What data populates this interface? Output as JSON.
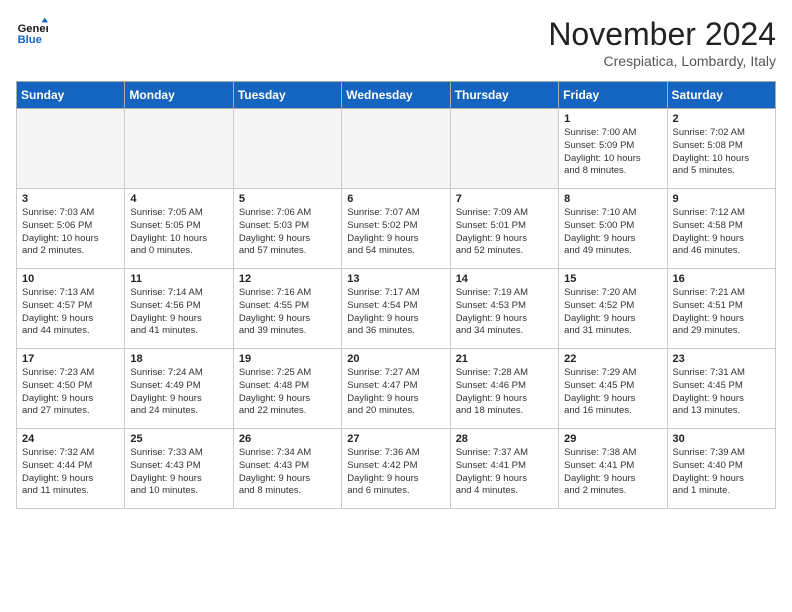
{
  "header": {
    "logo_line1": "General",
    "logo_line2": "Blue",
    "month": "November 2024",
    "location": "Crespiatica, Lombardy, Italy"
  },
  "weekdays": [
    "Sunday",
    "Monday",
    "Tuesday",
    "Wednesday",
    "Thursday",
    "Friday",
    "Saturday"
  ],
  "weeks": [
    [
      {
        "day": "",
        "info": ""
      },
      {
        "day": "",
        "info": ""
      },
      {
        "day": "",
        "info": ""
      },
      {
        "day": "",
        "info": ""
      },
      {
        "day": "",
        "info": ""
      },
      {
        "day": "1",
        "info": "Sunrise: 7:00 AM\nSunset: 5:09 PM\nDaylight: 10 hours\nand 8 minutes."
      },
      {
        "day": "2",
        "info": "Sunrise: 7:02 AM\nSunset: 5:08 PM\nDaylight: 10 hours\nand 5 minutes."
      }
    ],
    [
      {
        "day": "3",
        "info": "Sunrise: 7:03 AM\nSunset: 5:06 PM\nDaylight: 10 hours\nand 2 minutes."
      },
      {
        "day": "4",
        "info": "Sunrise: 7:05 AM\nSunset: 5:05 PM\nDaylight: 10 hours\nand 0 minutes."
      },
      {
        "day": "5",
        "info": "Sunrise: 7:06 AM\nSunset: 5:03 PM\nDaylight: 9 hours\nand 57 minutes."
      },
      {
        "day": "6",
        "info": "Sunrise: 7:07 AM\nSunset: 5:02 PM\nDaylight: 9 hours\nand 54 minutes."
      },
      {
        "day": "7",
        "info": "Sunrise: 7:09 AM\nSunset: 5:01 PM\nDaylight: 9 hours\nand 52 minutes."
      },
      {
        "day": "8",
        "info": "Sunrise: 7:10 AM\nSunset: 5:00 PM\nDaylight: 9 hours\nand 49 minutes."
      },
      {
        "day": "9",
        "info": "Sunrise: 7:12 AM\nSunset: 4:58 PM\nDaylight: 9 hours\nand 46 minutes."
      }
    ],
    [
      {
        "day": "10",
        "info": "Sunrise: 7:13 AM\nSunset: 4:57 PM\nDaylight: 9 hours\nand 44 minutes."
      },
      {
        "day": "11",
        "info": "Sunrise: 7:14 AM\nSunset: 4:56 PM\nDaylight: 9 hours\nand 41 minutes."
      },
      {
        "day": "12",
        "info": "Sunrise: 7:16 AM\nSunset: 4:55 PM\nDaylight: 9 hours\nand 39 minutes."
      },
      {
        "day": "13",
        "info": "Sunrise: 7:17 AM\nSunset: 4:54 PM\nDaylight: 9 hours\nand 36 minutes."
      },
      {
        "day": "14",
        "info": "Sunrise: 7:19 AM\nSunset: 4:53 PM\nDaylight: 9 hours\nand 34 minutes."
      },
      {
        "day": "15",
        "info": "Sunrise: 7:20 AM\nSunset: 4:52 PM\nDaylight: 9 hours\nand 31 minutes."
      },
      {
        "day": "16",
        "info": "Sunrise: 7:21 AM\nSunset: 4:51 PM\nDaylight: 9 hours\nand 29 minutes."
      }
    ],
    [
      {
        "day": "17",
        "info": "Sunrise: 7:23 AM\nSunset: 4:50 PM\nDaylight: 9 hours\nand 27 minutes."
      },
      {
        "day": "18",
        "info": "Sunrise: 7:24 AM\nSunset: 4:49 PM\nDaylight: 9 hours\nand 24 minutes."
      },
      {
        "day": "19",
        "info": "Sunrise: 7:25 AM\nSunset: 4:48 PM\nDaylight: 9 hours\nand 22 minutes."
      },
      {
        "day": "20",
        "info": "Sunrise: 7:27 AM\nSunset: 4:47 PM\nDaylight: 9 hours\nand 20 minutes."
      },
      {
        "day": "21",
        "info": "Sunrise: 7:28 AM\nSunset: 4:46 PM\nDaylight: 9 hours\nand 18 minutes."
      },
      {
        "day": "22",
        "info": "Sunrise: 7:29 AM\nSunset: 4:45 PM\nDaylight: 9 hours\nand 16 minutes."
      },
      {
        "day": "23",
        "info": "Sunrise: 7:31 AM\nSunset: 4:45 PM\nDaylight: 9 hours\nand 13 minutes."
      }
    ],
    [
      {
        "day": "24",
        "info": "Sunrise: 7:32 AM\nSunset: 4:44 PM\nDaylight: 9 hours\nand 11 minutes."
      },
      {
        "day": "25",
        "info": "Sunrise: 7:33 AM\nSunset: 4:43 PM\nDaylight: 9 hours\nand 10 minutes."
      },
      {
        "day": "26",
        "info": "Sunrise: 7:34 AM\nSunset: 4:43 PM\nDaylight: 9 hours\nand 8 minutes."
      },
      {
        "day": "27",
        "info": "Sunrise: 7:36 AM\nSunset: 4:42 PM\nDaylight: 9 hours\nand 6 minutes."
      },
      {
        "day": "28",
        "info": "Sunrise: 7:37 AM\nSunset: 4:41 PM\nDaylight: 9 hours\nand 4 minutes."
      },
      {
        "day": "29",
        "info": "Sunrise: 7:38 AM\nSunset: 4:41 PM\nDaylight: 9 hours\nand 2 minutes."
      },
      {
        "day": "30",
        "info": "Sunrise: 7:39 AM\nSunset: 4:40 PM\nDaylight: 9 hours\nand 1 minute."
      }
    ]
  ]
}
